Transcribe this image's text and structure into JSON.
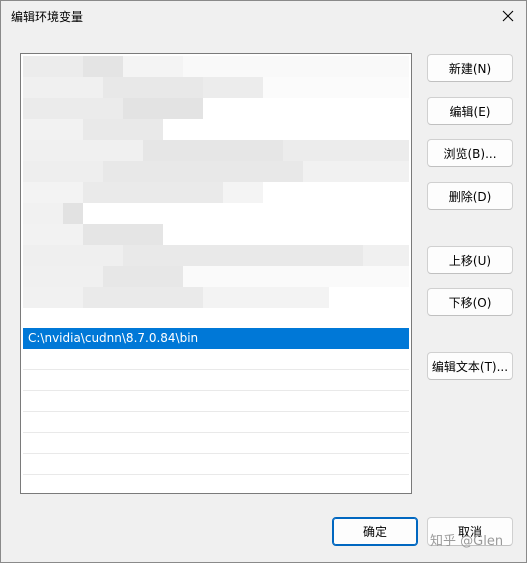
{
  "window": {
    "title": "编辑环境变量"
  },
  "list": {
    "blurred_rows": 13,
    "selected_item": "C:\\nvidia\\cudnn\\8.7.0.84\\bin",
    "empty_rows": 7
  },
  "buttons": {
    "new": "新建(N)",
    "edit": "编辑(E)",
    "browse": "浏览(B)...",
    "delete": "删除(D)",
    "move_up": "上移(U)",
    "move_down": "下移(O)",
    "edit_text": "编辑文本(T)...",
    "ok": "确定",
    "cancel": "取消"
  },
  "watermark": "知乎 @Glen",
  "colors": {
    "selection": "#0078d7",
    "dialog_bg": "#f0f0f0",
    "primary_border": "#0067c0"
  },
  "icons": {
    "close": "close-icon"
  }
}
